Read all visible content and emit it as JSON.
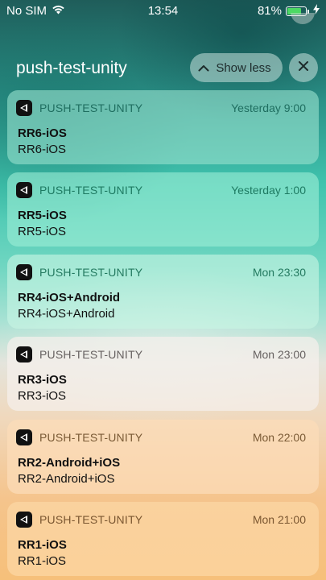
{
  "status_bar": {
    "carrier": "No SIM",
    "time": "13:54",
    "battery_percent": "81%",
    "battery_level": 0.81,
    "battery_color": "#4cd964",
    "icons": [
      "wifi-icon",
      "battery-icon",
      "charging-bolt-icon"
    ]
  },
  "group": {
    "title": "push-test-unity",
    "show_less_label": "Show less",
    "show_less_icon": "chevron-up-icon",
    "close_icon": "close-icon"
  },
  "notifications": [
    {
      "app_name": "PUSH-TEST-UNITY",
      "time": "Yesterday 9:00",
      "title": "RR6-iOS",
      "body": "RR6-iOS",
      "bg": "rgba(150,225,205,0.62)",
      "meta_color": "#1f6e60"
    },
    {
      "app_name": "PUSH-TEST-UNITY",
      "time": "Yesterday 1:00",
      "title": "RR5-iOS",
      "body": "RR5-iOS",
      "bg": "rgba(160,240,215,0.58)",
      "meta_color": "#1e7a62"
    },
    {
      "app_name": "PUSH-TEST-UNITY",
      "time": "Mon 23:30",
      "title": "RR4-iOS+Android",
      "body": "RR4-iOS+Android",
      "bg": "rgba(200,245,228,0.62)",
      "meta_color": "#247a60"
    },
    {
      "app_name": "PUSH-TEST-UNITY",
      "time": "Mon 23:00",
      "title": "RR3-iOS",
      "body": "RR3-iOS",
      "bg": "rgba(245,240,235,0.72)",
      "meta_color": "#666160"
    },
    {
      "app_name": "PUSH-TEST-UNITY",
      "time": "Mon 22:00",
      "title": "RR2-Android+iOS",
      "body": "RR2-Android+iOS",
      "bg": "rgba(252,220,185,0.72)",
      "meta_color": "#7a5a35"
    },
    {
      "app_name": "PUSH-TEST-UNITY",
      "time": "Mon 21:00",
      "title": "RR1-iOS",
      "body": "RR1-iOS",
      "bg": "rgba(252,215,165,0.72)",
      "meta_color": "#7a5630"
    }
  ]
}
